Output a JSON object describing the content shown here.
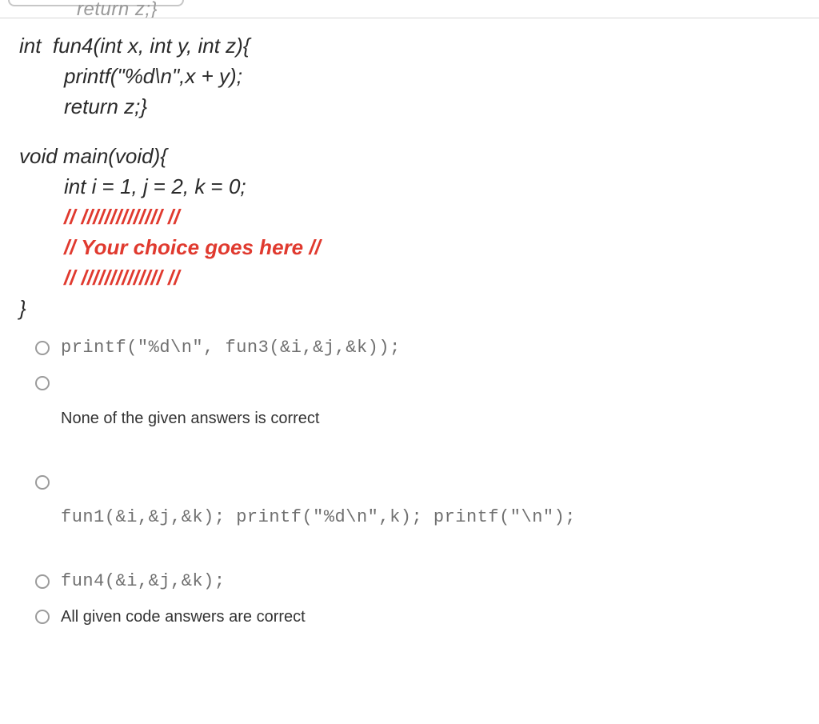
{
  "cutoff_line": "return z;}",
  "code": {
    "l1": "int  fun4(int x, int y, int z){",
    "l2": "printf(\"%d\\n\",x + y);",
    "l3": "return z;}",
    "l4": "void main(void){",
    "l5_pre": "int i ",
    "l5_eq1": "=",
    "l5_mid1": " 1, j ",
    "l5_eq2": "=",
    "l5_mid2": " 2, k ",
    "l5_eq3": "=",
    "l5_post": " 0;",
    "c1": "// ////////////// //",
    "c2": "// Your choice goes here //",
    "c3": "// ////////////// //",
    "l6": "}"
  },
  "options": {
    "o1": "printf(\"%d\\n\", fun3(&i,&j,&k));",
    "o2": "None of the given answers is correct",
    "o3": "fun1(&i,&j,&k); printf(\"%d\\n\",k); printf(\"\\n\");",
    "o4": "fun4(&i,&j,&k);",
    "o5": "All given code answers are correct"
  }
}
